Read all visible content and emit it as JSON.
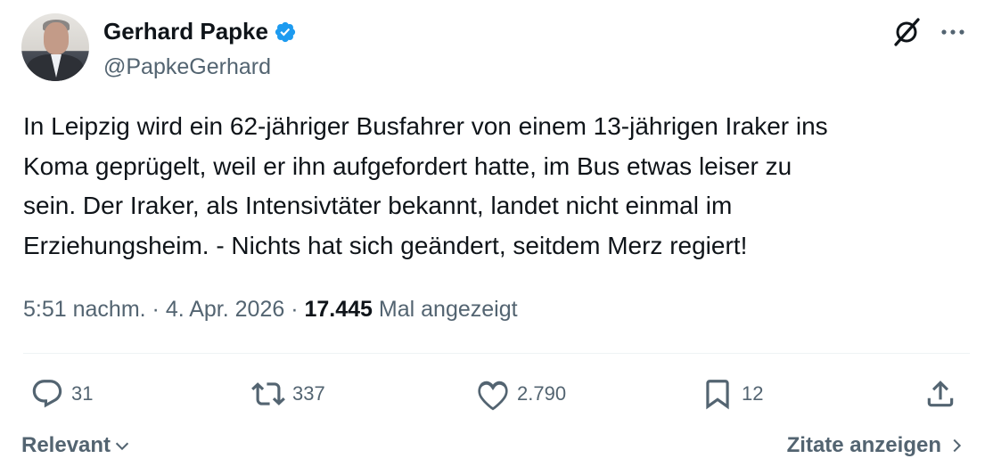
{
  "author": {
    "display_name": "Gerhard Papke",
    "handle": "@PapkeGerhard",
    "verified": true,
    "verified_color": "#1d9bf0"
  },
  "tweet": {
    "text": "In Leipzig wird ein 62-jähriger Busfahrer von einem 13-jährigen Iraker ins\nKoma geprügelt, weil er ihn aufgefordert hatte, im Bus etwas leiser zu\nsein. Der Iraker, als Intensivtäter bekannt, landet nicht einmal im\nErziehungsheim. - Nichts hat sich geändert, seitdem Merz regiert!"
  },
  "meta": {
    "time": "5:51 nachm.",
    "separator": " · ",
    "date": "4. Apr. 2026",
    "views_count": "17.445",
    "views_label": "Mal angezeigt"
  },
  "actions": {
    "replies": "31",
    "reposts": "337",
    "likes": "2.790",
    "bookmarks": "12"
  },
  "footer": {
    "sort_label": "Relevant",
    "quotes_label": "Zitate anzeigen"
  },
  "icons": [
    "grok-icon",
    "more-icon",
    "reply-icon",
    "repost-icon",
    "like-icon",
    "bookmark-icon",
    "share-icon",
    "chevron-down-icon",
    "chevron-right-icon",
    "verified-badge-icon"
  ]
}
